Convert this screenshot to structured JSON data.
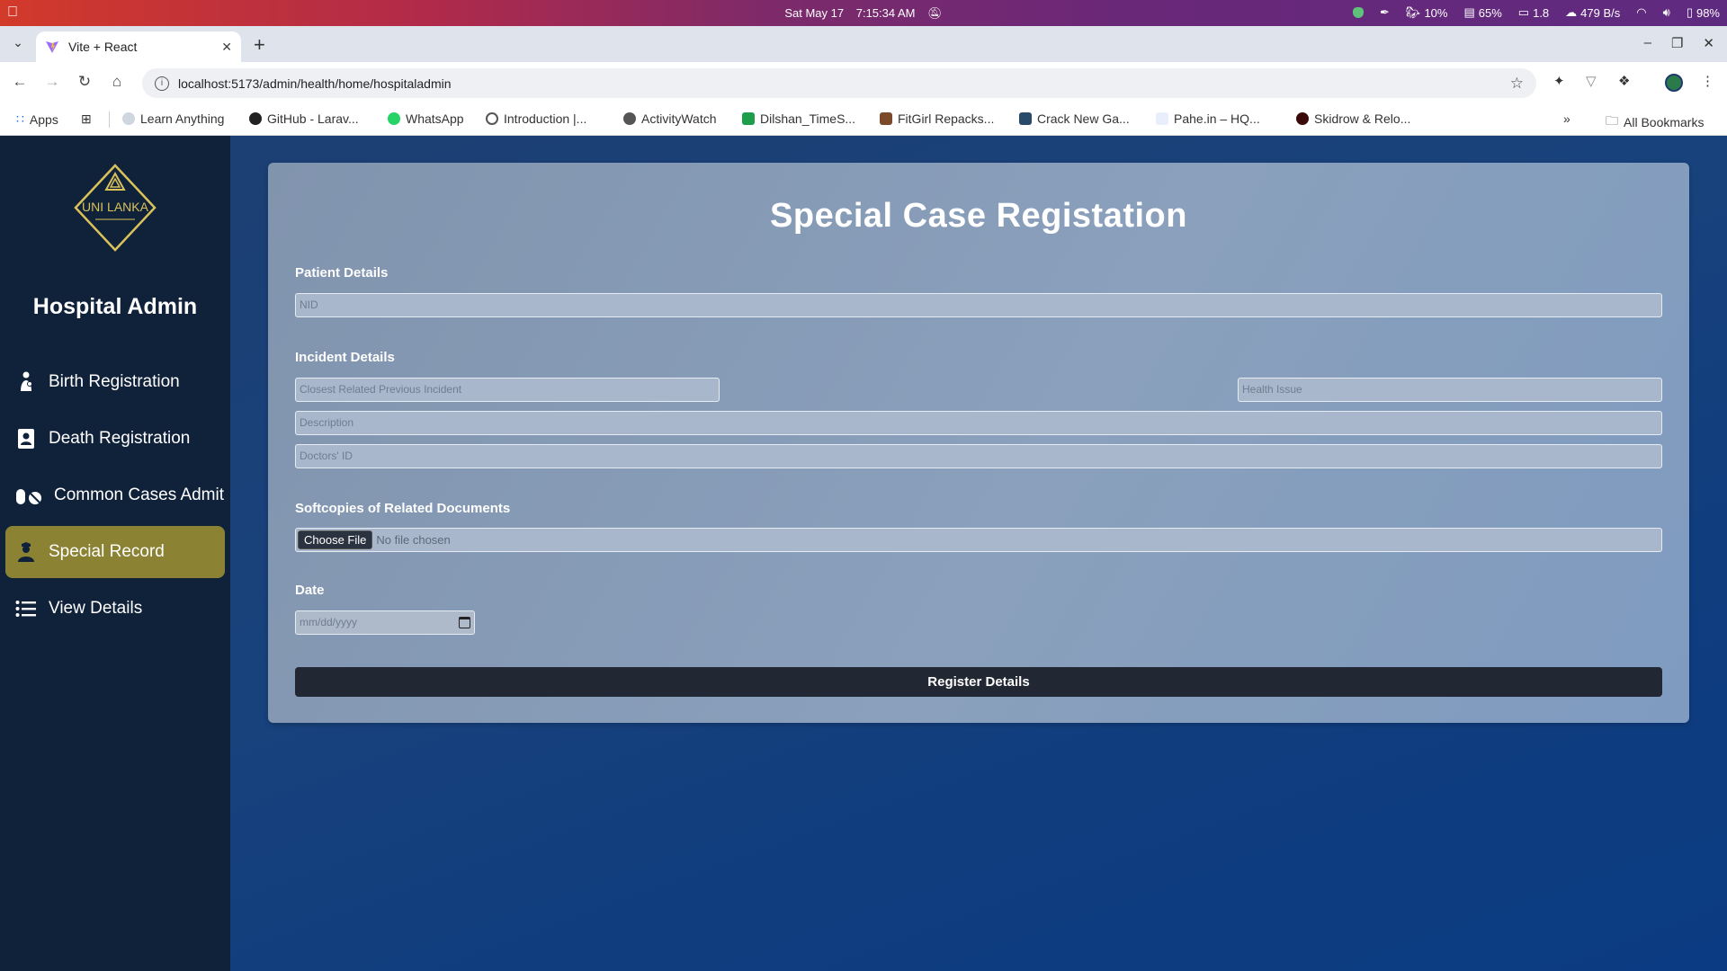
{
  "os": {
    "date": "Sat May 17",
    "time": "7:15:34 AM",
    "tray": {
      "cpu": "10%",
      "memory": "65%",
      "load": "1.8",
      "network": "479 B/s",
      "battery": "98%"
    }
  },
  "browser": {
    "tab_title": "Vite + React",
    "url": "localhost:5173/admin/health/home/hospitaladmin",
    "bookmarks": [
      "Apps",
      "Learn Anything",
      "GitHub - Larav...",
      "WhatsApp",
      "Introduction |...",
      "ActivityWatch",
      "Dilshan_TimeS...",
      "FitGirl Repacks...",
      "Crack New Ga...",
      "Pahe.in – HQ...",
      "Skidrow & Relo..."
    ],
    "all_bookmarks": "All Bookmarks"
  },
  "sidebar": {
    "logo_text": "UNI LANKA",
    "title": "Hospital Admin",
    "items": [
      {
        "label": "Birth Registration",
        "icon": "person-baby-icon"
      },
      {
        "label": "Death Registration",
        "icon": "document-person-icon"
      },
      {
        "label": "Common Cases Admit",
        "icon": "pills-icon"
      },
      {
        "label": "Special Record",
        "icon": "user-nurse-icon",
        "active": true
      },
      {
        "label": "View Details",
        "icon": "list-icon"
      }
    ]
  },
  "form": {
    "title": "Special Case Registation",
    "patient_section": "Patient Details",
    "nid_placeholder": "NID",
    "incident_section": "Incident Details",
    "incident_placeholder": "Closest Related Previous Incident",
    "health_issue_placeholder": "Health Issue",
    "description_placeholder": "Description",
    "doctors_id_placeholder": "Doctors' ID",
    "docs_section": "Softcopies of Related Documents",
    "file_button": "Choose File",
    "file_status": "No file chosen",
    "date_section": "Date",
    "date_placeholder": "mm/dd/yyyy",
    "submit_label": "Register Details"
  },
  "colors": {
    "sidebar_bg": "#10213a",
    "active_item": "#8b8234",
    "card_bg": "#8a9cb6",
    "button_bg": "#212733",
    "logo_gold": "#d9c25a"
  }
}
